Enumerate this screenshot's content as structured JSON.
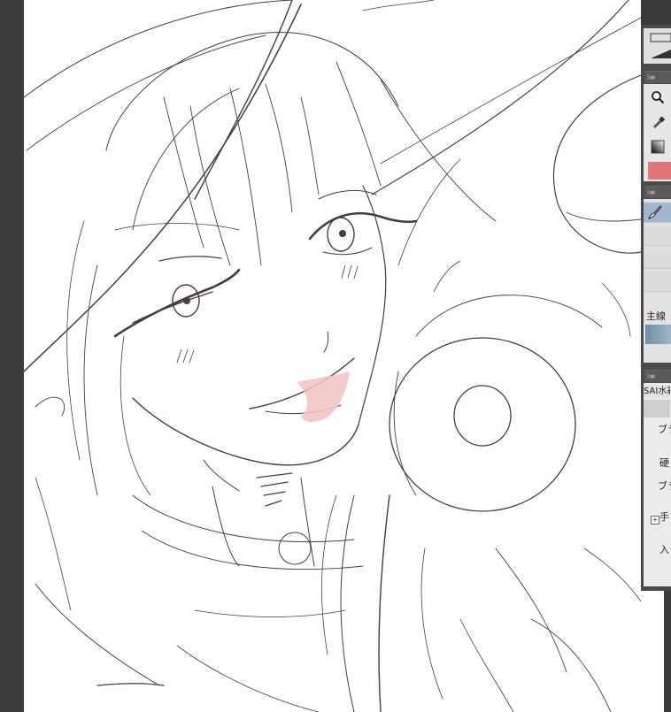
{
  "panel": {
    "brush_group_label": "主線",
    "sai_section_title": "SAI水彩",
    "properties": {
      "brush_shape_label": "ブラ",
      "hardness_label": "硬",
      "brush_density_label": "ブラ",
      "stabilizer_label": "手",
      "input_label": "入"
    }
  },
  "colors": {
    "main_color": "#e07679",
    "canvas_background": "#ffffff",
    "panel_background": "#4a4a4a",
    "sketch_line": "#4a3b3c",
    "lip_tint": "#f2c2c2"
  },
  "icons": [
    "zoom-icon",
    "eyedropper-icon",
    "gradient-icon",
    "brush-icon"
  ]
}
